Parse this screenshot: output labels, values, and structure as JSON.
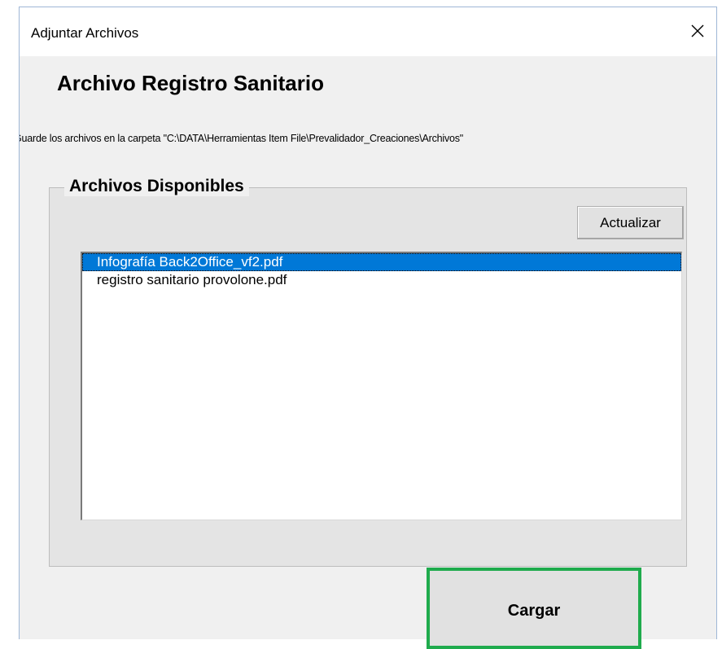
{
  "window": {
    "title": "Adjuntar Archivos"
  },
  "heading": "Archivo Registro Sanitario",
  "save_path_text": "Guarde los archivos en la carpeta \"C:\\DATA\\Herramientas Item File\\Prevalidador_Creaciones\\Archivos\"",
  "group": {
    "label": "Archivos Disponibles",
    "refresh_label": "Actualizar"
  },
  "files": [
    {
      "name": "Infografía Back2Office_vf2.pdf",
      "selected": true
    },
    {
      "name": "registro sanitario provolone.pdf",
      "selected": false
    }
  ],
  "upload_label": "Cargar",
  "colors": {
    "selection": "#0078d7",
    "highlight_border": "#1fab4d"
  }
}
